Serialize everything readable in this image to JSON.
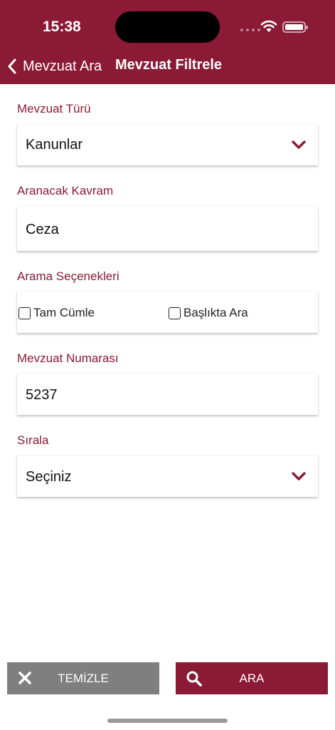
{
  "status_bar": {
    "time": "15:38"
  },
  "nav": {
    "back_label": "Mevzuat Ara",
    "title": "Mevzuat Filtrele"
  },
  "form": {
    "type": {
      "label": "Mevzuat Türü",
      "value": "Kanunlar"
    },
    "keyword": {
      "label": "Aranacak Kavram",
      "value": "Ceza"
    },
    "options": {
      "label": "Arama Seçenekleri",
      "items": [
        {
          "label": "Tam Cümle",
          "checked": false
        },
        {
          "label": "Başlıkta Ara",
          "checked": false
        }
      ]
    },
    "number": {
      "label": "Mevzuat Numarası",
      "value": "5237"
    },
    "sort": {
      "label": "Sırala",
      "value": "Seçiniz"
    }
  },
  "buttons": {
    "clear_label": "TEMİZLE",
    "search_label": "ARA"
  },
  "colors": {
    "brand": "#8b1a36",
    "clear_button": "#7f7f7f"
  }
}
